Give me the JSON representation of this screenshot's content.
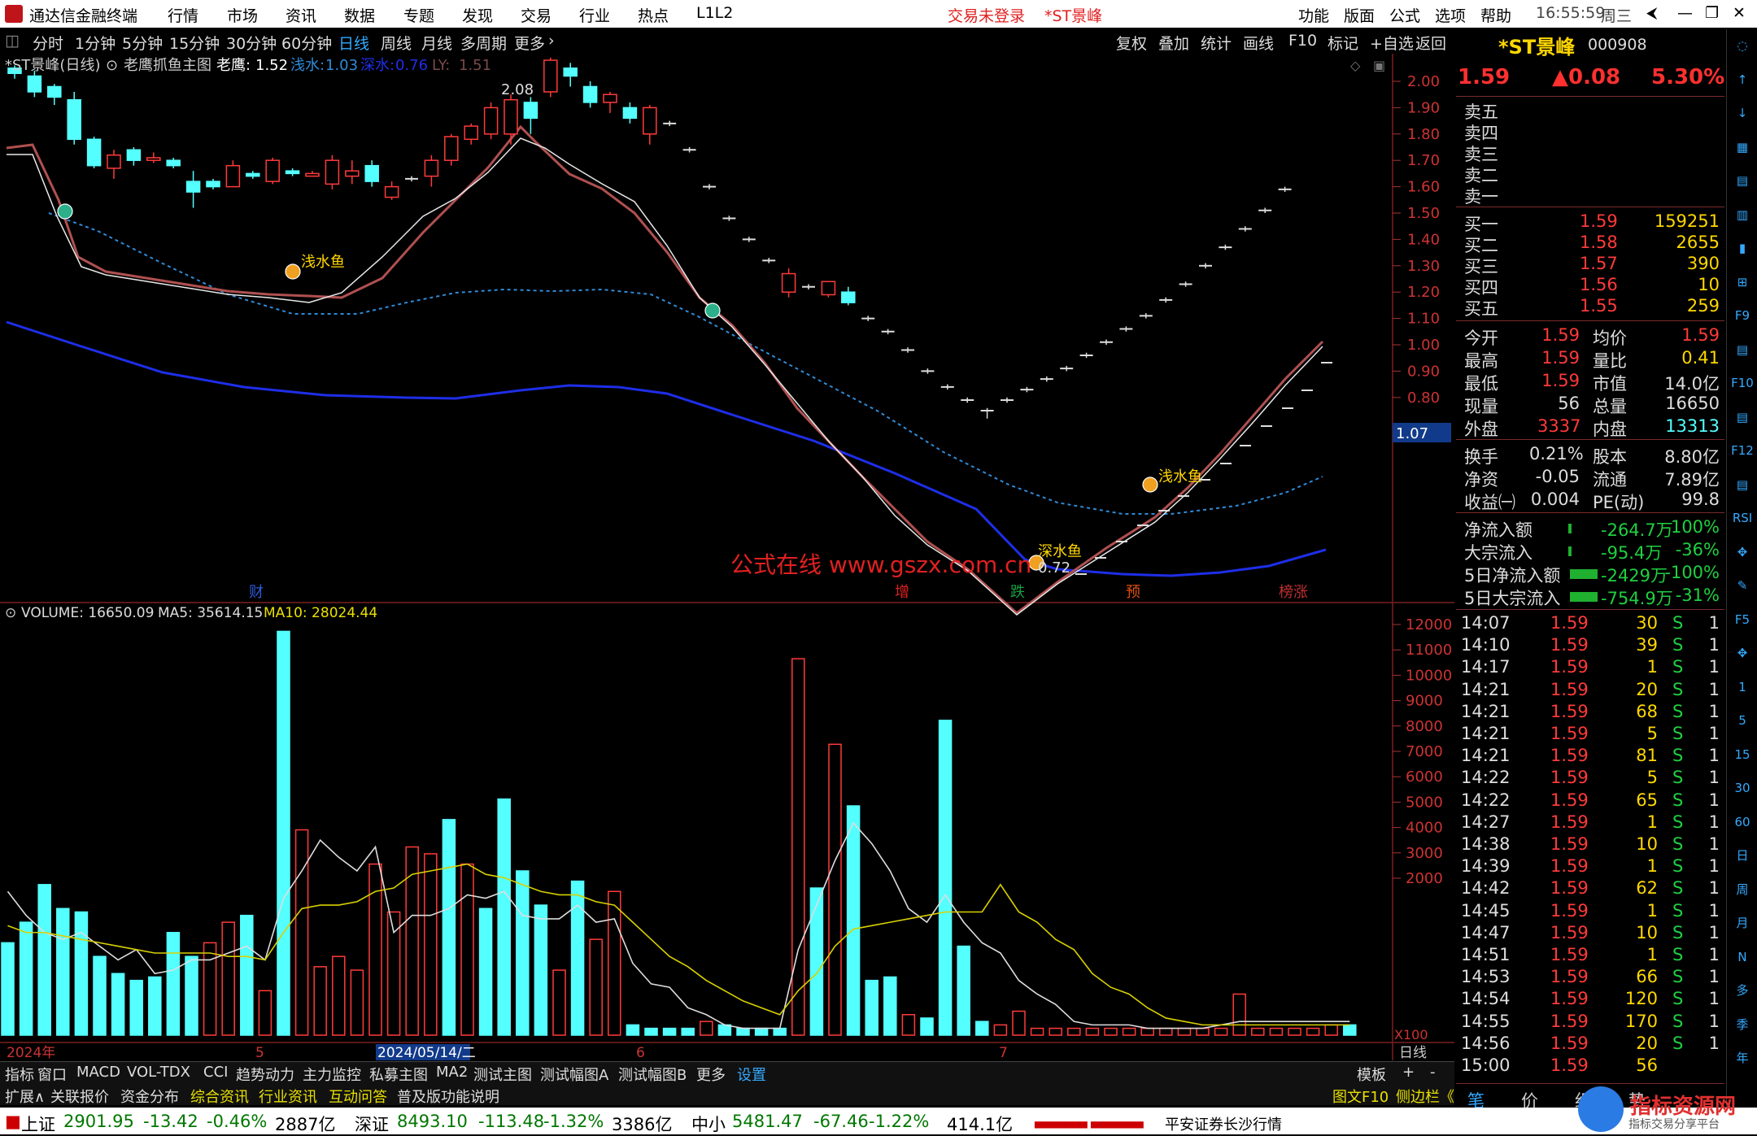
{
  "titlebar": {
    "app_name": "通达信金融终端",
    "menu": [
      "行情",
      "市场",
      "资讯",
      "数据",
      "专题",
      "发现",
      "交易",
      "行业",
      "热点",
      "L1L2"
    ],
    "trade_status": "交易未登录",
    "stock_tag": "*ST景峰",
    "right_menu": [
      "功能",
      "版面",
      "公式",
      "选项",
      "帮助"
    ],
    "time": "16:55:59",
    "weekday": "周三"
  },
  "toolbar": {
    "periods": [
      "分时",
      "1分钟",
      "5分钟",
      "15分钟",
      "30分钟",
      "60分钟",
      "日线",
      "周线",
      "月线",
      "多周期",
      "更多"
    ],
    "selected": "日线",
    "actions": [
      "复权",
      "叠加",
      "统计",
      "画线",
      "F10",
      "标记",
      "+自选",
      "返回"
    ]
  },
  "main_chart": {
    "header_name": "*ST景峰(日线)",
    "indicator": "老鹰抓鱼主图",
    "laoying_label": "老鹰:",
    "laoying_value": "1.52",
    "qianshui_label": "浅水:",
    "qianshui_value": "1.03",
    "shenshui_label": "深水:",
    "shenshui_value": "0.76",
    "ly_label": "LY:",
    "ly_value": "1.51",
    "high_mark": "2.08",
    "low_mark": "0.72",
    "signals": [
      "浅水鱼",
      "浅水鱼",
      "深水鱼",
      "浅水鱼"
    ],
    "watermark": "公式在线  www.gszx.com.cn",
    "current_price_tag": "1.07",
    "event_tags": [
      "财",
      "增",
      "跌",
      "预",
      "榜涨"
    ],
    "price_ticks": [
      "2.00",
      "1.90",
      "1.80",
      "1.70",
      "1.60",
      "1.50",
      "1.40",
      "1.30",
      "1.20",
      "1.10",
      "1.00",
      "0.90",
      "0.80"
    ],
    "colors": {
      "up": "#ff3a3a",
      "down": "#54ffff",
      "shallow": "#2e8bd8",
      "deep": "#1e2ee8",
      "laoying": "#b05050"
    }
  },
  "volume_chart": {
    "label": "VOLUME: 16650.09",
    "ma5": "MA5: 35614.15",
    "ma10": "MA10: 28024.44",
    "ticks": [
      "12000",
      "11000",
      "10000",
      "9000",
      "8000",
      "7000",
      "6000",
      "5000",
      "4000",
      "3000",
      "2000"
    ],
    "unit": "X100",
    "date_labels": [
      "2024年",
      "5",
      "2024/05/14/二",
      "6",
      "7"
    ],
    "period_tag": "日线"
  },
  "tabs_row1": [
    "指标",
    "窗口",
    "MACD",
    "VOL-TDX",
    "CCI",
    "趋势动力",
    "主力监控",
    "私募主图",
    "MA2",
    "测试主图",
    "测试幅图A",
    "测试幅图B",
    "更多",
    "设置"
  ],
  "tabs_row1_right": [
    "模板",
    "+",
    "-"
  ],
  "tabs_row2": [
    "扩展∧",
    "关联报价",
    "资金分布",
    "综合资讯",
    "行业资讯",
    "互动问答",
    "普及版功能说明"
  ],
  "tabs_row2_right": [
    "图文F10",
    "侧边栏《"
  ],
  "quote_panel": {
    "name": "*ST景峰",
    "code": "000908",
    "price": "1.59",
    "change": "▲0.08",
    "pct": "5.30%",
    "asks": [
      [
        "卖五",
        "",
        ""
      ],
      [
        "卖四",
        "",
        ""
      ],
      [
        "卖三",
        "",
        ""
      ],
      [
        "卖二",
        "",
        ""
      ],
      [
        "卖一",
        "",
        ""
      ]
    ],
    "bids": [
      [
        "买一",
        "1.59",
        "159251"
      ],
      [
        "买二",
        "1.58",
        "2655"
      ],
      [
        "买三",
        "1.57",
        "390"
      ],
      [
        "买四",
        "1.56",
        "10"
      ],
      [
        "买五",
        "1.55",
        "259"
      ]
    ],
    "stats": [
      [
        "今开",
        "1.59",
        "均价",
        "1.59"
      ],
      [
        "最高",
        "1.59",
        "量比",
        "0.41"
      ],
      [
        "最低",
        "1.59",
        "市值",
        "14.0亿"
      ],
      [
        "现量",
        "56",
        "总量",
        "16650"
      ],
      [
        "外盘",
        "3337",
        "内盘",
        "13313"
      ]
    ],
    "fund": [
      [
        "换手",
        "0.21%",
        "股本",
        "8.80亿"
      ],
      [
        "净资",
        "-0.05",
        "流通",
        "7.89亿"
      ],
      [
        "收益㈠",
        "0.004",
        "PE(动)",
        "99.8"
      ]
    ],
    "flows": [
      [
        "净流入额",
        "-264.7万",
        "-100%"
      ],
      [
        "大宗流入",
        "-95.4万",
        "-36%"
      ],
      [
        "5日净流入额",
        "-2429万",
        "-100%"
      ],
      [
        "5日大宗流入",
        "-754.9万",
        "-31%"
      ]
    ],
    "ticks": [
      [
        "14:07",
        "1.59",
        "30",
        "S",
        "1"
      ],
      [
        "14:10",
        "1.59",
        "39",
        "S",
        "1"
      ],
      [
        "14:17",
        "1.59",
        "1",
        "S",
        "1"
      ],
      [
        "14:21",
        "1.59",
        "20",
        "S",
        "1"
      ],
      [
        "14:21",
        "1.59",
        "68",
        "S",
        "1"
      ],
      [
        "14:21",
        "1.59",
        "5",
        "S",
        "1"
      ],
      [
        "14:21",
        "1.59",
        "81",
        "S",
        "1"
      ],
      [
        "14:22",
        "1.59",
        "5",
        "S",
        "1"
      ],
      [
        "14:22",
        "1.59",
        "65",
        "S",
        "1"
      ],
      [
        "14:27",
        "1.59",
        "1",
        "S",
        "1"
      ],
      [
        "14:38",
        "1.59",
        "10",
        "S",
        "1"
      ],
      [
        "14:39",
        "1.59",
        "1",
        "S",
        "1"
      ],
      [
        "14:42",
        "1.59",
        "62",
        "S",
        "1"
      ],
      [
        "14:45",
        "1.59",
        "1",
        "S",
        "1"
      ],
      [
        "14:47",
        "1.59",
        "10",
        "S",
        "1"
      ],
      [
        "14:51",
        "1.59",
        "1",
        "S",
        "1"
      ],
      [
        "14:53",
        "1.59",
        "66",
        "S",
        "1"
      ],
      [
        "14:54",
        "1.59",
        "120",
        "S",
        "1"
      ],
      [
        "14:55",
        "1.59",
        "170",
        "S",
        "1"
      ],
      [
        "14:56",
        "1.59",
        "20",
        "S",
        "1"
      ],
      [
        "15:00",
        "1.59",
        "56",
        "",
        ""
      ]
    ],
    "bottom_tabs": [
      "笔",
      "价",
      "细",
      "势"
    ]
  },
  "iconbar": [
    "◌",
    "↑",
    "↓",
    "▦",
    "▤",
    "▥",
    "▮",
    "⊞",
    "F9",
    "▤",
    "F10",
    "▤",
    "F12",
    "▤",
    "RSI",
    "✥",
    "✎",
    "F5",
    "✥",
    "1",
    "5",
    "15",
    "30",
    "60",
    "日",
    "周",
    "月",
    "N",
    "多",
    "季",
    "年"
  ],
  "statusbar": {
    "items": [
      {
        "label": "上证",
        "val": "2901.95",
        "chg": "-13.42",
        "pct": "-0.46%",
        "amt": "2887亿"
      },
      {
        "label": "深证",
        "val": "8493.10",
        "chg": "-113.48",
        "pct": "-1.32%",
        "amt": "3386亿"
      },
      {
        "label": "中小",
        "val": "5481.47",
        "chg": "-67.46",
        "pct": "-1.22%",
        "amt": "414.1亿"
      }
    ],
    "broker": "平安证券长沙行情",
    "badge": "指标资源网",
    "badge_sub": "指标交易分享平台"
  }
}
